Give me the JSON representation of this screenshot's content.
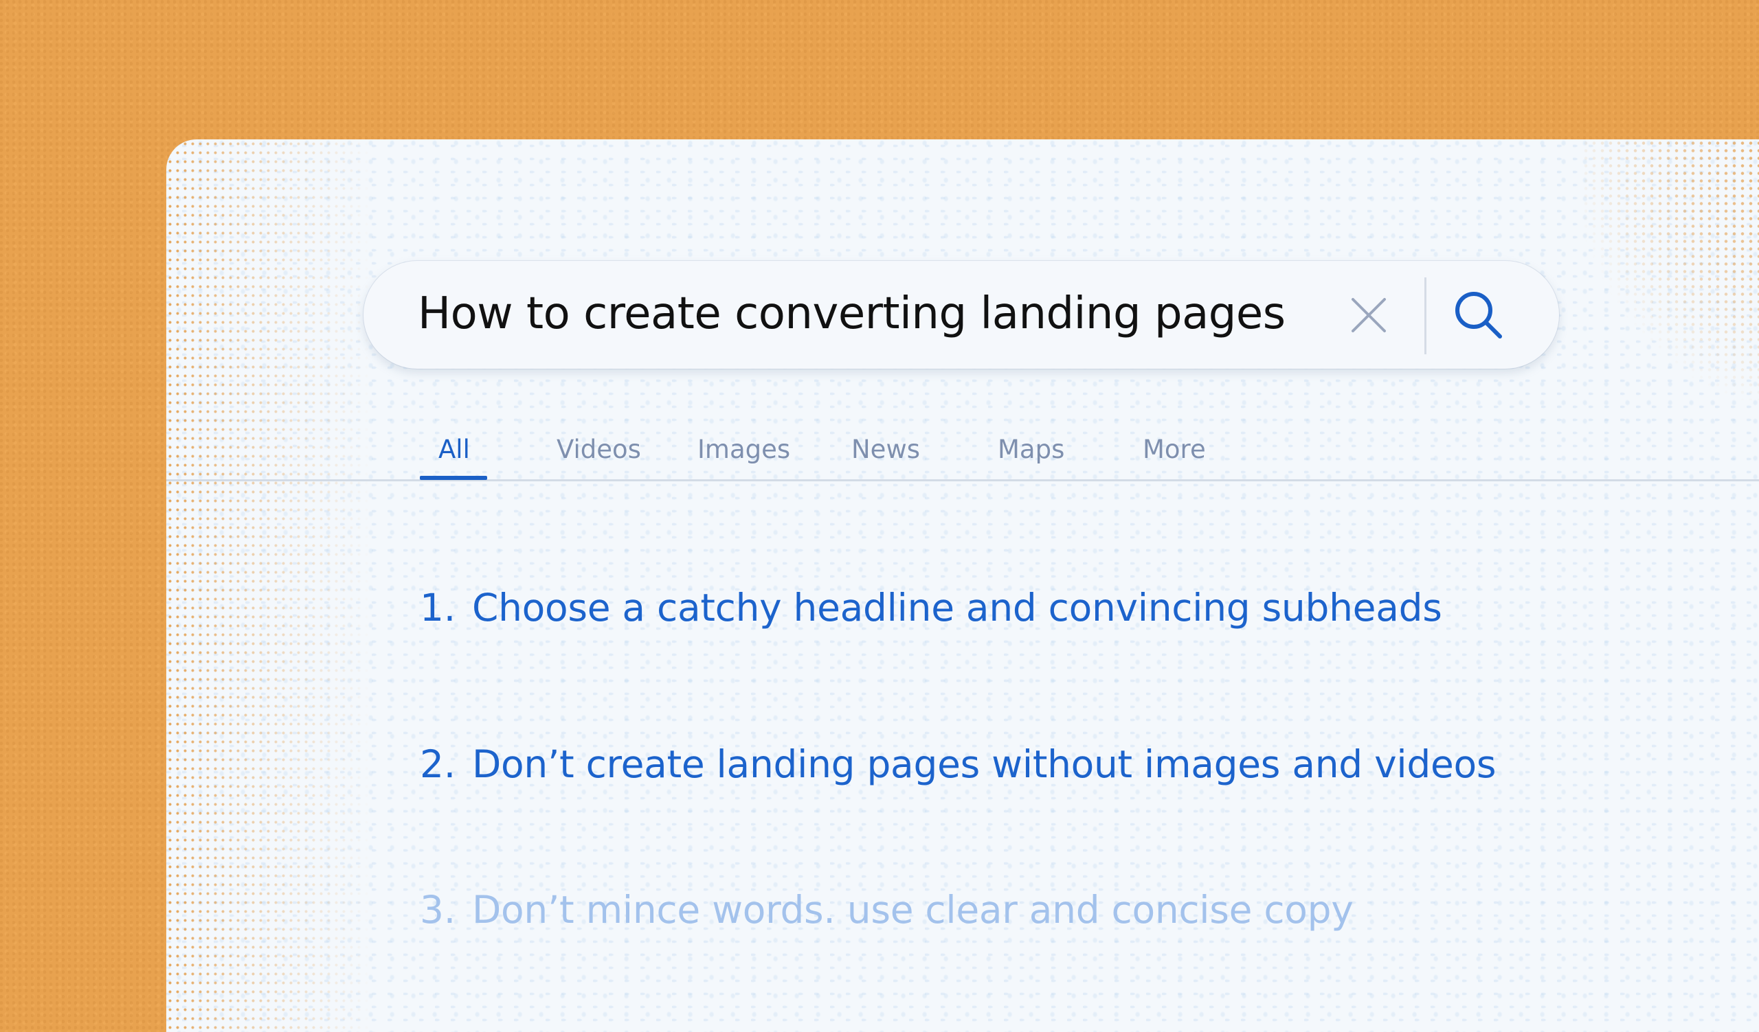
{
  "search": {
    "query": "How to create converting landing pages",
    "clear_icon": "close-icon",
    "submit_icon": "search-icon"
  },
  "tabs": [
    {
      "label": "All",
      "active": true
    },
    {
      "label": "Videos",
      "active": false
    },
    {
      "label": "Images",
      "active": false
    },
    {
      "label": "News",
      "active": false
    },
    {
      "label": "Maps",
      "active": false
    },
    {
      "label": "More",
      "active": false
    }
  ],
  "results": [
    {
      "number": "1.",
      "text": "Choose a catchy headline and convincing subheads"
    },
    {
      "number": "2.",
      "text": "Don’t create landing pages without images and videos"
    },
    {
      "number": "3.",
      "text": "Don’t mince words. use clear and concise copy"
    }
  ],
  "colors": {
    "background": "#E8A24F",
    "card": "#F4F8FC",
    "accent": "#1A5FC6",
    "tab_inactive": "#7E8FAE",
    "result_faded": "#A3C2EC"
  }
}
